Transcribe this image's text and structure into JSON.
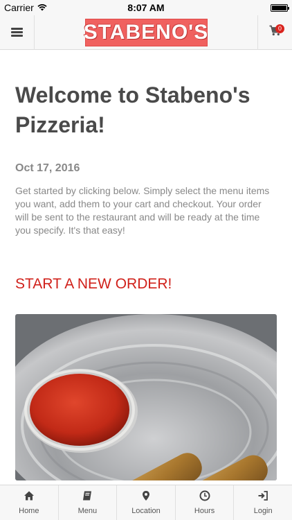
{
  "status_bar": {
    "carrier": "Carrier",
    "time": "8:07 AM"
  },
  "header": {
    "logo_text": "STABENO'S",
    "cart_count": "0"
  },
  "main": {
    "title": "Welcome to Stabeno's Pizzeria!",
    "date": "Oct 17, 2016",
    "description": "Get started by clicking below. Simply select the menu items you want, add them to your cart and checkout. Your order will be sent to the restaurant and will be ready at the time you specify. It's that easy!",
    "cta_label": "START A NEW ORDER!"
  },
  "tabs": [
    {
      "label": "Home",
      "icon": "home-icon"
    },
    {
      "label": "Menu",
      "icon": "book-icon"
    },
    {
      "label": "Location",
      "icon": "map-marker-icon"
    },
    {
      "label": "Hours",
      "icon": "clock-icon"
    },
    {
      "label": "Login",
      "icon": "login-icon"
    }
  ],
  "colors": {
    "accent": "#d0201a",
    "logo_bg": "#f0615f",
    "badge": "#d9231d"
  }
}
